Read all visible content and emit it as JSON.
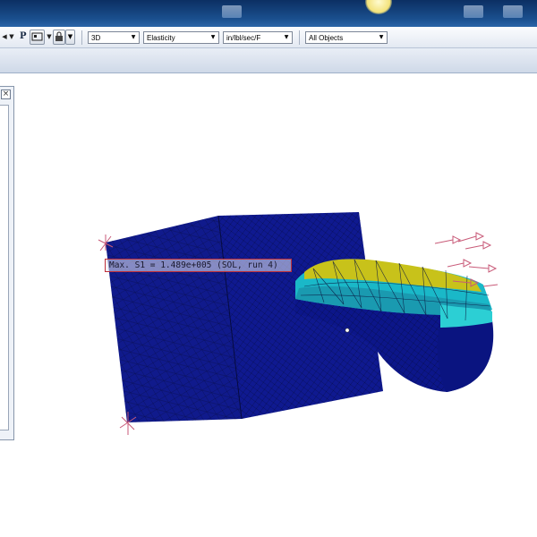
{
  "toolbar": {
    "letter_p": "P",
    "view_mode": "3D",
    "analysis_type": "Elasticity",
    "units": "in/lbl/sec/F",
    "object_filter": "All Objects"
  },
  "viewport": {
    "result_label": "Max. S1 =  1.489e+005 (SOL, run 4)"
  },
  "colors": {
    "mesh_body": "#101a8c",
    "contour_cyan": "#1ab8c8",
    "contour_yellow": "#c8c21a",
    "constraint_marker": "#c85a78"
  }
}
